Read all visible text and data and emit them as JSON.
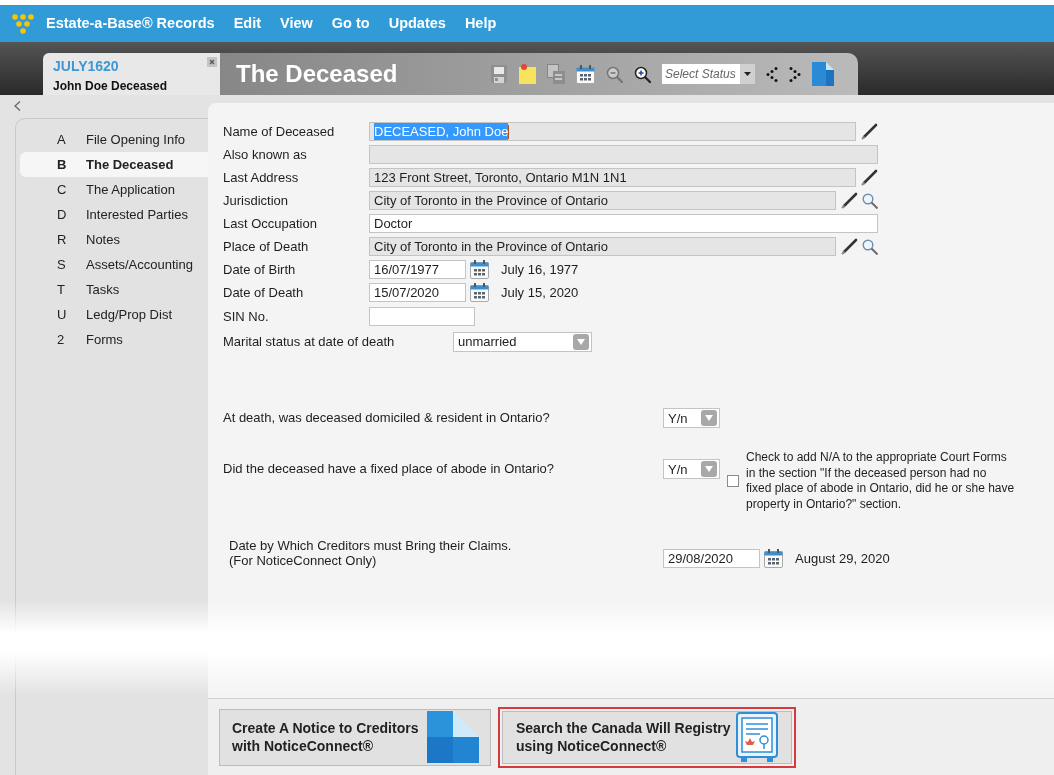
{
  "menu_bar": {
    "brand": "Estate-a-Base® Records",
    "items": [
      "Edit",
      "View",
      "Go to",
      "Updates",
      "Help"
    ]
  },
  "record_tab": {
    "code": "JULY1620",
    "name": "John Doe Deceased"
  },
  "page_header": {
    "title": "The Deceased",
    "toolbar": {
      "tools": [
        {
          "kind": "save",
          "disabled": false
        },
        {
          "kind": "note",
          "disabled": false
        },
        {
          "kind": "copy",
          "disabled": true
        },
        {
          "kind": "calendar",
          "disabled": false
        },
        {
          "kind": "zoom_out",
          "disabled": true
        },
        {
          "kind": "zoom_in",
          "disabled": false
        }
      ],
      "status_select": {
        "placeholder": "Select Status"
      },
      "nav_tools": [
        {
          "kind": "previous",
          "disabled": false
        },
        {
          "kind": "next",
          "disabled": false
        },
        {
          "kind": "document",
          "disabled": false
        }
      ]
    }
  },
  "sidebar": {
    "items": [
      {
        "letter": "A",
        "label": "File Opening Info",
        "selected": false
      },
      {
        "letter": "B",
        "label": "The Deceased",
        "selected": true
      },
      {
        "letter": "C",
        "label": "The Application",
        "selected": false
      },
      {
        "letter": "D",
        "label": "Interested Parties",
        "selected": false
      },
      {
        "letter": "R",
        "label": "Notes",
        "selected": false
      },
      {
        "letter": "S",
        "label": "Assets/Accounting",
        "selected": false
      },
      {
        "letter": "T",
        "label": "Tasks",
        "selected": false
      },
      {
        "letter": "U",
        "label": "Ledg/Prop Dist",
        "selected": false
      },
      {
        "letter": "2",
        "label": "Forms",
        "selected": false
      }
    ]
  },
  "form": {
    "fields": [
      {
        "kind": "text",
        "label": "Name of Deceased",
        "value": "DECEASED, John Doe",
        "readonly": true,
        "text_selected": true,
        "editable": true,
        "searchable": false
      },
      {
        "kind": "text",
        "label": "Also known as",
        "readonly": true,
        "text_selected": false,
        "editable": false,
        "searchable": false
      },
      {
        "kind": "text",
        "label": "Last Address",
        "value": "123 Front Street, Toronto, Ontario M1N 1N1",
        "readonly": true,
        "text_selected": false,
        "editable": true,
        "searchable": false
      },
      {
        "kind": "text",
        "label": "Jurisdiction",
        "value": "City of Toronto in the Province of Ontario",
        "readonly": true,
        "text_selected": false,
        "editable": true,
        "searchable": true
      },
      {
        "kind": "text",
        "label": "Last Occupation",
        "value": "Doctor",
        "readonly": false,
        "text_selected": false,
        "editable": false,
        "searchable": false
      },
      {
        "kind": "text",
        "label": "Place of Death",
        "value": "City of Toronto in the Province of Ontario",
        "readonly": true,
        "text_selected": false,
        "editable": true,
        "searchable": true
      },
      {
        "kind": "date",
        "label": "Date of Birth",
        "value": "16/07/1977",
        "date_text": "July 16, 1977",
        "readonly": false,
        "text_selected": false,
        "editable": false,
        "searchable": false
      },
      {
        "kind": "date",
        "label": "Date of Death",
        "value": "15/07/2020",
        "date_text": "July 15, 2020",
        "readonly": false,
        "text_selected": false,
        "editable": false,
        "searchable": false
      },
      {
        "kind": "short_text",
        "label": "SIN No.",
        "readonly": false,
        "text_selected": false,
        "editable": false,
        "searchable": false
      },
      {
        "kind": "select",
        "label": "Marital status at date of death",
        "value": "unmarried",
        "readonly": false,
        "text_selected": false,
        "editable": false,
        "searchable": false
      }
    ],
    "questions": [
      {
        "text": "At death, was deceased domiciled & resident in Ontario?",
        "value": "Y/n"
      },
      {
        "text": "Did the deceased have a fixed place of abode in Ontario?",
        "value": "Y/n",
        "checkbox": {
          "checked": false,
          "note": "Check to add N/A to the appropriate Court Forms\nin the section \"If the deceased person had no\nfixed place of abode in Ontario, did he or she have\nproperty in Ontario?\" section."
        }
      }
    ],
    "creditors_deadline": {
      "label": "Date by Which Creditors must Bring their Claims.",
      "sublabel": "(For NoticeConnect Only)",
      "value": "29/08/2020",
      "date_text": "August 29, 2020"
    }
  },
  "actions": [
    {
      "kind": "notice",
      "lines": [
        "Create A Notice to Creditors",
        "with NoticeConnect®"
      ],
      "highlighted": false
    },
    {
      "kind": "registry",
      "lines": [
        "Search the Canada Will Registry",
        "using NoticeConnect®"
      ],
      "highlighted": true
    }
  ]
}
